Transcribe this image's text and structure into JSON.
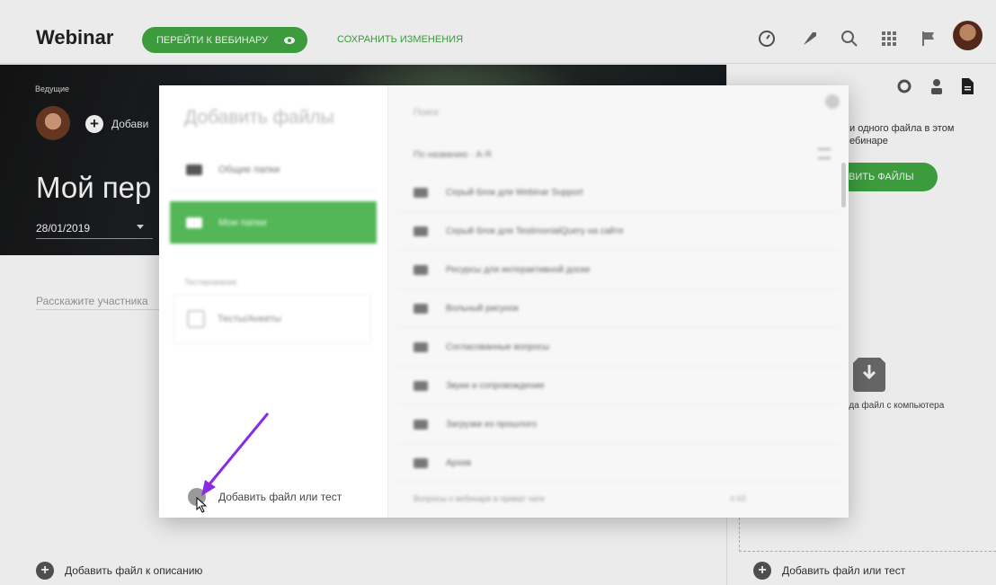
{
  "topbar": {
    "brand": "Webinar",
    "go_button": "ПЕРЕЙТИ К ВЕБИНАРУ",
    "save_link": "СОХРАНИТЬ ИЗМЕНЕНИЯ",
    "icons": [
      "speedometer-icon",
      "rocket-icon",
      "search-icon",
      "apps-grid-icon",
      "flag-icon",
      "user-avatar"
    ]
  },
  "hero": {
    "hosts_label": "Ведущие",
    "add_host": "Добави",
    "title": "Мой пер",
    "date": "28/01/2019"
  },
  "description": {
    "placeholder": "Расскажите участника",
    "add_file": "Добавить файл к описанию"
  },
  "right_panel": {
    "note": "и одного файла в этом\nебинаре",
    "upload_button": "ВИТЬ ФАЙЛЫ",
    "drop_text": "зда файл с компьютера",
    "add_file_or_test": "Добавить файл или тест"
  },
  "modal": {
    "title": "Добавить файлы",
    "sidebar": [
      {
        "label": "Общие папки",
        "active": false
      },
      {
        "label": "Мои папки",
        "active": true
      }
    ],
    "section_label": "Тестирование",
    "test_item": "Тесты/Анкеты",
    "add_file_or_test": "Добавить файл или тест",
    "search_placeholder": "Поиск",
    "sort_label": "По названию  ·  А-Я",
    "files": [
      "Серый блок для Webinar Support",
      "Серый блок для TestimonialQuery на сайте",
      "Ресурсы для интерактивной доски",
      "Вольный рисунок",
      "Согласованные вопросы",
      "Звуки и сопровождение",
      "Загрузки из прошлого",
      "Архив"
    ],
    "footer_left": "Вопросы о вебинаре в приват чате",
    "footer_right": "4 Кб"
  },
  "colors": {
    "accent": "#40a943",
    "active_folder": "#53b657",
    "annotation_arrow": "#8a2be2"
  }
}
